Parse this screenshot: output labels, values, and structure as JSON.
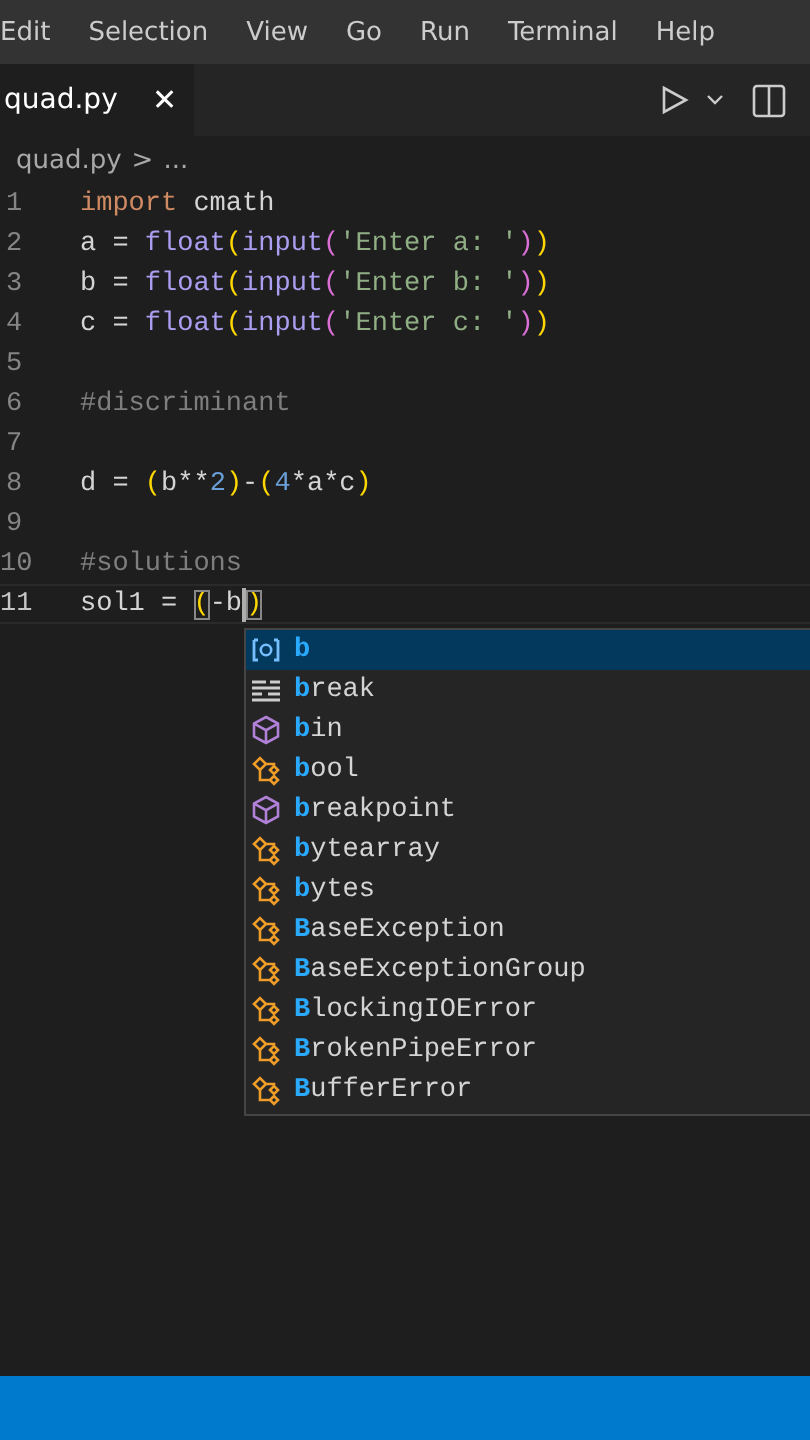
{
  "menu": [
    "Edit",
    "Selection",
    "View",
    "Go",
    "Run",
    "Terminal",
    "Help"
  ],
  "tab": {
    "label": "quad.py",
    "close": "✕"
  },
  "breadcrumb": {
    "file": "quad.py",
    "separator": ">",
    "rest": "..."
  },
  "lines": [
    {
      "number": "1",
      "tokens": [
        {
          "kind": "keyword",
          "text": "import"
        },
        {
          "kind": "plain",
          "text": " cmath"
        }
      ]
    },
    {
      "number": "2",
      "tokens": [
        {
          "kind": "plain",
          "text": "a = "
        },
        {
          "kind": "function",
          "text": "float"
        },
        {
          "kind": "bracket1",
          "text": "("
        },
        {
          "kind": "function",
          "text": "input"
        },
        {
          "kind": "bracket2",
          "text": "("
        },
        {
          "kind": "string",
          "text": "'Enter a: '"
        },
        {
          "kind": "bracket2",
          "text": ")"
        },
        {
          "kind": "bracket1",
          "text": ")"
        }
      ]
    },
    {
      "number": "3",
      "tokens": [
        {
          "kind": "plain",
          "text": "b = "
        },
        {
          "kind": "function",
          "text": "float"
        },
        {
          "kind": "bracket1",
          "text": "("
        },
        {
          "kind": "function",
          "text": "input"
        },
        {
          "kind": "bracket2",
          "text": "("
        },
        {
          "kind": "string",
          "text": "'Enter b: '"
        },
        {
          "kind": "bracket2",
          "text": ")"
        },
        {
          "kind": "bracket1",
          "text": ")"
        }
      ]
    },
    {
      "number": "4",
      "tokens": [
        {
          "kind": "plain",
          "text": "c = "
        },
        {
          "kind": "function",
          "text": "float"
        },
        {
          "kind": "bracket1",
          "text": "("
        },
        {
          "kind": "function",
          "text": "input"
        },
        {
          "kind": "bracket2",
          "text": "("
        },
        {
          "kind": "string",
          "text": "'Enter c: '"
        },
        {
          "kind": "bracket2",
          "text": ")"
        },
        {
          "kind": "bracket1",
          "text": ")"
        }
      ]
    },
    {
      "number": "5"
    },
    {
      "number": "6",
      "tokens": [
        {
          "kind": "comment",
          "text": "#discriminant"
        }
      ]
    },
    {
      "number": "7"
    },
    {
      "number": "8",
      "tokens": [
        {
          "kind": "plain",
          "text": "d = "
        },
        {
          "kind": "bracket1",
          "text": "("
        },
        {
          "kind": "plain",
          "text": "b**"
        },
        {
          "kind": "number",
          "text": "2"
        },
        {
          "kind": "bracket1",
          "text": ")"
        },
        {
          "kind": "plain",
          "text": "-"
        },
        {
          "kind": "bracket1",
          "text": "("
        },
        {
          "kind": "number",
          "text": "4"
        },
        {
          "kind": "plain",
          "text": "*a*c"
        },
        {
          "kind": "bracket1",
          "text": ")"
        }
      ]
    },
    {
      "number": "9"
    },
    {
      "number": "10",
      "tokens": [
        {
          "kind": "comment",
          "text": "#solutions"
        }
      ]
    },
    {
      "number": "11",
      "current": true,
      "tokens": [
        {
          "kind": "plain",
          "text": "sol1 = "
        },
        {
          "kind": "matched",
          "text": "("
        },
        {
          "kind": "plain",
          "text": "-b"
        },
        {
          "kind": "matched",
          "text": ")"
        }
      ]
    }
  ],
  "suggestions": [
    {
      "kind": "variable",
      "match": "b",
      "selected": true
    },
    {
      "kind": "keyword",
      "match": "b",
      "rest": "reak",
      "selected": false
    },
    {
      "kind": "function",
      "match": "b",
      "rest": "in",
      "selected": false
    },
    {
      "kind": "class",
      "match": "b",
      "rest": "ool",
      "selected": false
    },
    {
      "kind": "function",
      "match": "b",
      "rest": "reakpoint",
      "selected": false
    },
    {
      "kind": "class",
      "match": "b",
      "rest": "ytearray",
      "selected": false
    },
    {
      "kind": "class",
      "match": "b",
      "rest": "ytes",
      "selected": false
    },
    {
      "kind": "class",
      "match": "B",
      "rest": "aseException",
      "selected": false
    },
    {
      "kind": "class",
      "match": "B",
      "rest": "aseExceptionGroup",
      "selected": false
    },
    {
      "kind": "class",
      "match": "B",
      "rest": "lockingIOError",
      "selected": false
    },
    {
      "kind": "class",
      "match": "B",
      "rest": "rokenPipeError",
      "selected": false
    },
    {
      "kind": "class",
      "match": "B",
      "rest": "ufferError",
      "selected": false
    }
  ]
}
